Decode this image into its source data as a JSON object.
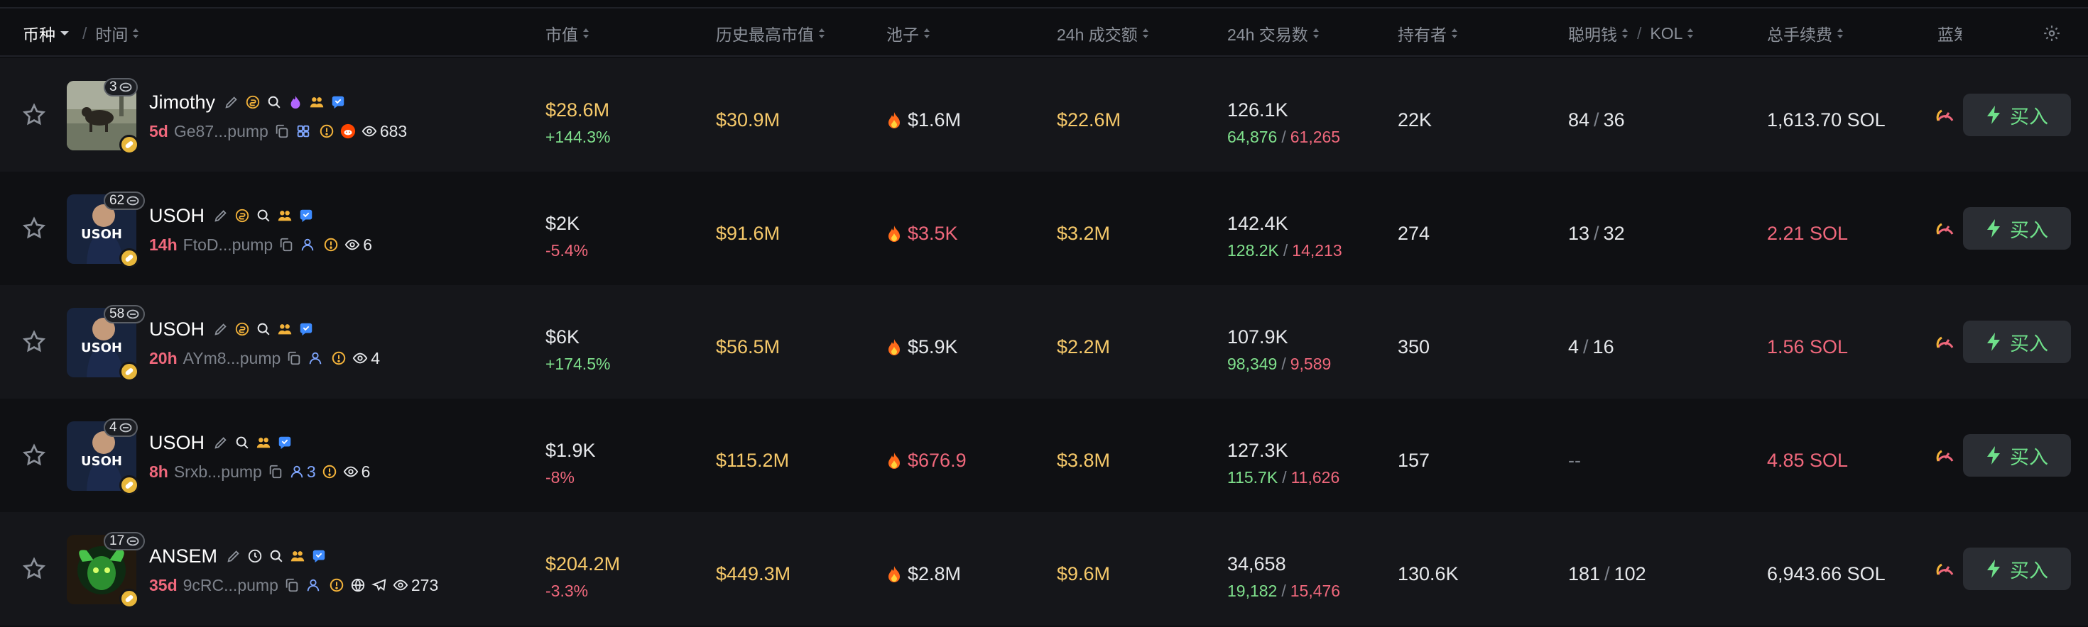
{
  "header": {
    "coin": "币种",
    "time": "时间",
    "market_cap": "市值",
    "ath_market_cap": "历史最高市值",
    "pool": "池子",
    "volume_24h": "24h 成交额",
    "txns_24h": "24h 交易数",
    "holders": "持有者",
    "smart_money": "聪明钱",
    "kol": "KOL",
    "total_fees": "总手续费",
    "blue_chip": "蓝筹"
  },
  "buy_label": "买入",
  "tokens": [
    {
      "name": "Jimothy",
      "badge_count": "3",
      "age": "5d",
      "address": "Ge87...pump",
      "holder_count": "",
      "views": "683",
      "market_cap": "$28.6M",
      "market_cap_change": "+144.3%",
      "change_dir": "up",
      "ath_market_cap": "$30.9M",
      "pool": "$1.6M",
      "pool_color": "white",
      "volume": "$22.6M",
      "txns": "126.1K",
      "buys": "64,876",
      "sells": "61,265",
      "holders": "22K",
      "smart_money": "84",
      "kol": "36",
      "total_fees": "1,613.70 SOL",
      "fees_color": "white",
      "mc_color": "yellow"
    },
    {
      "name": "USOH",
      "badge_count": "62",
      "age": "14h",
      "address": "FtoD...pump",
      "holder_count": "",
      "views": "6",
      "market_cap": "$2K",
      "market_cap_change": "-5.4%",
      "change_dir": "down",
      "ath_market_cap": "$91.6M",
      "pool": "$3.5K",
      "pool_color": "red",
      "volume": "$3.2M",
      "txns": "142.4K",
      "buys": "128.2K",
      "sells": "14,213",
      "holders": "274",
      "smart_money": "13",
      "kol": "32",
      "total_fees": "2.21 SOL",
      "fees_color": "red",
      "mc_color": "white"
    },
    {
      "name": "USOH",
      "badge_count": "58",
      "age": "20h",
      "address": "AYm8...pump",
      "holder_count": "",
      "views": "4",
      "market_cap": "$6K",
      "market_cap_change": "+174.5%",
      "change_dir": "up",
      "ath_market_cap": "$56.5M",
      "pool": "$5.9K",
      "pool_color": "white",
      "volume": "$2.2M",
      "txns": "107.9K",
      "buys": "98,349",
      "sells": "9,589",
      "holders": "350",
      "smart_money": "4",
      "kol": "16",
      "total_fees": "1.56 SOL",
      "fees_color": "red",
      "mc_color": "white"
    },
    {
      "name": "USOH",
      "badge_count": "4",
      "age": "8h",
      "address": "Srxb...pump",
      "holder_count": "3",
      "views": "6",
      "market_cap": "$1.9K",
      "market_cap_change": "-8%",
      "change_dir": "down",
      "ath_market_cap": "$115.2M",
      "pool": "$676.9",
      "pool_color": "red",
      "volume": "$3.8M",
      "txns": "127.3K",
      "buys": "115.7K",
      "sells": "11,626",
      "holders": "157",
      "smart_money": "--",
      "kol": "",
      "total_fees": "4.85 SOL",
      "fees_color": "red",
      "mc_color": "white"
    },
    {
      "name": "ANSEM",
      "badge_count": "17",
      "age": "35d",
      "address": "9cRC...pump",
      "holder_count": "",
      "views": "273",
      "market_cap": "$204.2M",
      "market_cap_change": "-3.3%",
      "change_dir": "down",
      "ath_market_cap": "$449.3M",
      "pool": "$2.8M",
      "pool_color": "white",
      "volume": "$9.6M",
      "txns": "34,658",
      "buys": "19,182",
      "sells": "15,476",
      "holders": "130.6K",
      "smart_money": "181",
      "kol": "102",
      "total_fees": "6,943.66 SOL",
      "fees_color": "white",
      "mc_color": "yellow"
    }
  ]
}
